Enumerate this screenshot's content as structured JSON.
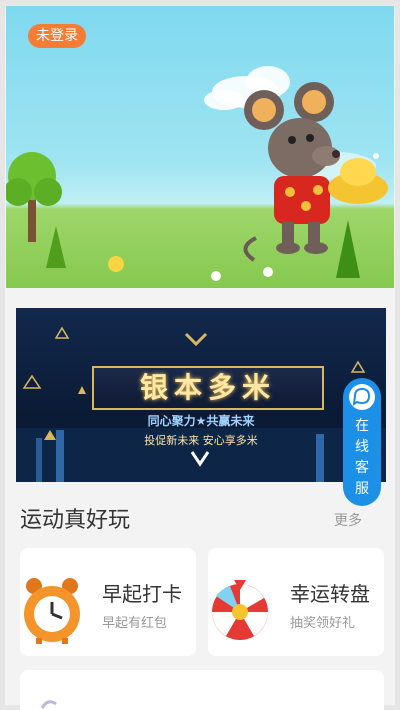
{
  "hero": {
    "badge_label": "未登录"
  },
  "banner": {
    "title": "银本多米",
    "subtitle": "同心聚力★共赢未来",
    "tagline": "投促新未来 安心享多米"
  },
  "service_float": {
    "label_chars": [
      "在",
      "线",
      "客",
      "服"
    ]
  },
  "section": {
    "title": "运动真好玩",
    "more_label": "更多"
  },
  "cards": [
    {
      "title": "早起打卡",
      "subtitle": "早起有红包"
    },
    {
      "title": "幸运转盘",
      "subtitle": "抽奖领好礼"
    }
  ],
  "colors": {
    "badge": "#f47d35",
    "service": "#1c8fe6",
    "sky": "#7fd9ef",
    "grass": "#86c94f",
    "banner_bg": "#0b1b36"
  }
}
